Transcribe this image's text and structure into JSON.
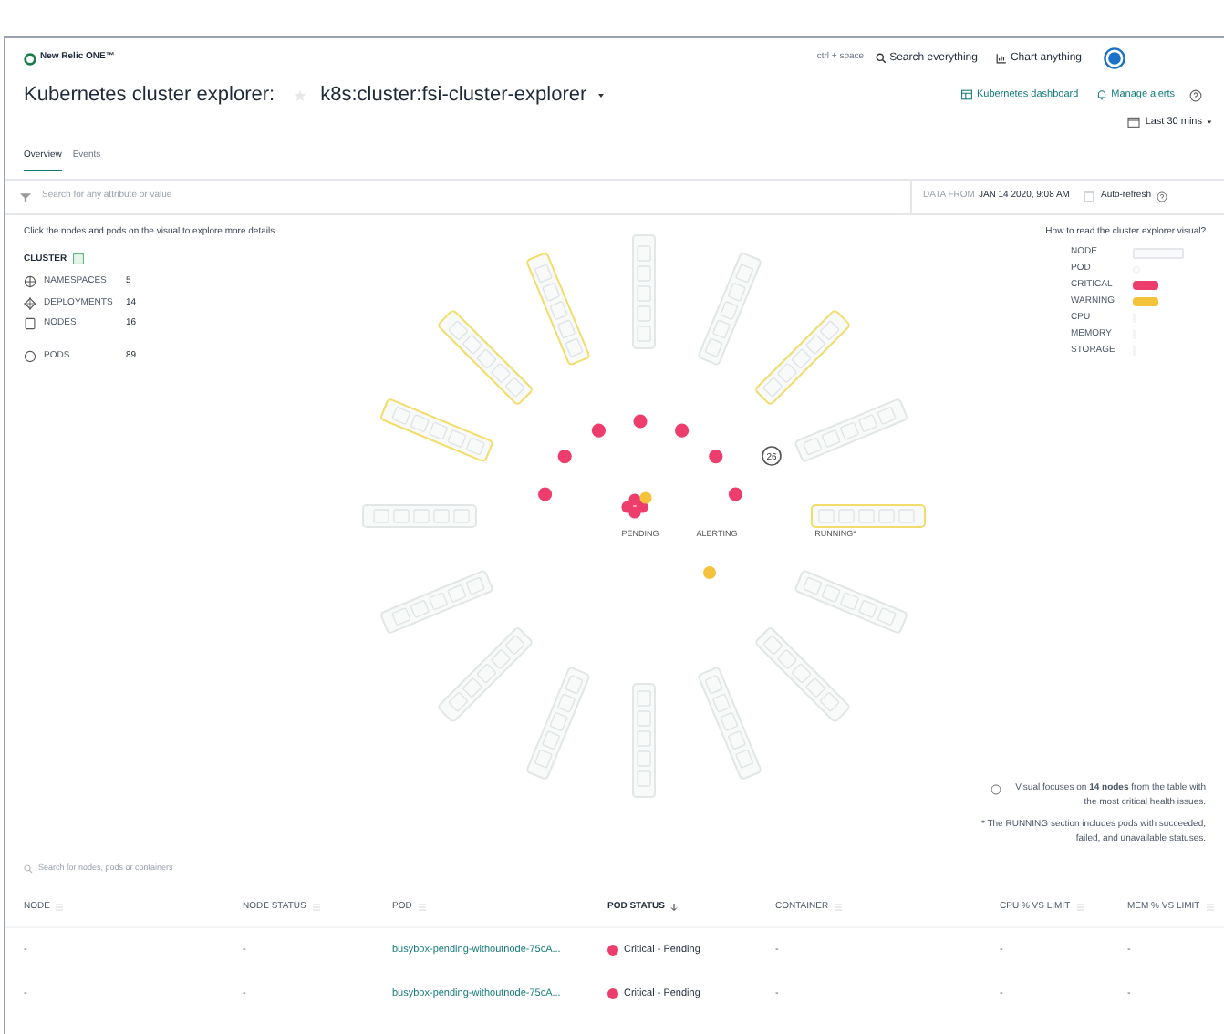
{
  "brand": {
    "name": "New Relic ONE™"
  },
  "top_actions": {
    "shortcut": "ctrl + space",
    "search": "Search everything",
    "chart": "Chart anything"
  },
  "title": {
    "label": "Kubernetes cluster explorer:",
    "cluster": "k8s:cluster:fsi-cluster-explorer"
  },
  "links": [
    {
      "kind": "dashboard",
      "label": "Kubernetes dashboard"
    },
    {
      "kind": "alerts",
      "label": "Manage alerts"
    }
  ],
  "time_picker": "Last 30 mins",
  "tabs": [
    {
      "label": "Overview",
      "selected": true
    },
    {
      "label": "Events",
      "selected": false
    }
  ],
  "filter": {
    "placeholder": "Search for any attribute or value",
    "data_from_label": "DATA FROM",
    "data_from": "JAN 14 2020, 9:08 AM",
    "auto_refresh": {
      "label": "Auto-refresh",
      "checked": false
    }
  },
  "hint": "Click the nodes and pods on the visual to explore more details.",
  "cluster": {
    "heading": "CLUSTER",
    "stats": [
      {
        "kind": "namespaces",
        "label": "NAMESPACES",
        "value": "5"
      },
      {
        "kind": "deployments",
        "label": "DEPLOYMENTS",
        "value": "14"
      },
      {
        "kind": "nodes",
        "label": "NODES",
        "value": "16"
      },
      {
        "kind": "pods",
        "label": "PODS",
        "value": "89"
      }
    ]
  },
  "visual": {
    "sections": [
      "PENDING",
      "ALERTING",
      "RUNNING*"
    ],
    "node_badge": "26",
    "nodes": [
      {
        "warning": false
      },
      {
        "warning": false
      },
      {
        "warning": true
      },
      {
        "warning": false
      },
      {
        "warning": true
      },
      {
        "warning": false
      },
      {
        "warning": false
      },
      {
        "warning": false
      },
      {
        "warning": false
      },
      {
        "warning": false
      },
      {
        "warning": false
      },
      {
        "warning": false
      },
      {
        "warning": false
      },
      {
        "warning": true
      },
      {
        "warning": true
      },
      {
        "warning": true
      }
    ],
    "pending_pods": [
      {
        "color": "#ec3d6c"
      },
      {
        "color": "#ec3d6c"
      },
      {
        "color": "#ec3d6c"
      },
      {
        "color": "#ec3d6c"
      },
      {
        "color": "#f5c23c"
      }
    ],
    "outer_pods": [
      {
        "color": "#ec3d6c"
      },
      {
        "color": "#ec3d6c"
      },
      {
        "color": "#ec3d6c"
      },
      {
        "color": "#ec3d6c"
      },
      {
        "color": "#ec3d6c"
      },
      {
        "color": "#ec3d6c"
      },
      {
        "color": "#ec3d6c"
      }
    ],
    "alerting_pods": [
      {
        "color": "#f5c23c"
      }
    ]
  },
  "legend": {
    "title": "How to read the cluster explorer visual?",
    "items": [
      {
        "kind": "node",
        "label": "NODE"
      },
      {
        "kind": "pod",
        "label": "POD"
      },
      {
        "kind": "critical",
        "label": "CRITICAL"
      },
      {
        "kind": "warning",
        "label": "WARNING"
      },
      {
        "kind": "cpu",
        "label": "CPU"
      },
      {
        "kind": "memory",
        "label": "MEMORY"
      },
      {
        "kind": "storage",
        "label": "STORAGE"
      }
    ]
  },
  "notes": [
    "Visual focuses on **14 nodes** from the table with the most critical health issues.",
    "* The RUNNING section includes pods with succeeded, failed, and unavailable statuses."
  ],
  "table": {
    "search_placeholder": "Search for nodes, pods or containers",
    "columns": [
      {
        "label": "NODE",
        "sorted": false
      },
      {
        "label": "NODE STATUS",
        "sorted": false
      },
      {
        "label": "POD",
        "sorted": false
      },
      {
        "label": "POD STATUS",
        "sorted": true
      },
      {
        "label": "CONTAINER",
        "sorted": false
      },
      {
        "label": "CPU % VS LIMIT",
        "sorted": false
      },
      {
        "label": "MEM % VS LIMIT",
        "sorted": false
      }
    ],
    "rows": [
      {
        "node": "-",
        "node_status": "-",
        "pod": "busybox-pending-withoutnode-75cA...",
        "pod_status": {
          "kind": "critical",
          "label": "Critical - Pending"
        },
        "container": "-",
        "cpu": "-",
        "mem": "-"
      },
      {
        "node": "-",
        "node_status": "-",
        "pod": "busybox-pending-withoutnode-75cA...",
        "pod_status": {
          "kind": "critical",
          "label": "Critical - Pending"
        },
        "container": "-",
        "cpu": "-",
        "mem": "-"
      }
    ]
  }
}
